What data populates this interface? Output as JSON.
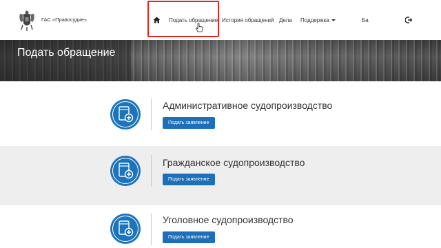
{
  "header": {
    "brand": "ГАС «Правосудие»",
    "nav": {
      "home_icon": "home-icon",
      "submit_appeal": "Подать обращение",
      "appeal_history": "История обращений",
      "cases": "Дела",
      "support": "Поддержка"
    },
    "user": "Ба",
    "logout_icon": "logout-icon"
  },
  "banner": {
    "title": "Подать обращение"
  },
  "sections": [
    {
      "title": "Административное судопроизводство",
      "button": "Подать заявление",
      "icon": "document-add-icon"
    },
    {
      "title": "Гражданское судопроизводство",
      "button": "Подать заявление",
      "icon": "document-add-icon"
    },
    {
      "title": "Уголовное судопроизводство",
      "button": "Подать заявление",
      "icon": "document-add-icon"
    }
  ],
  "colors": {
    "accent": "#1c75bc",
    "button": "#1c6fb8",
    "highlight": "#e32424",
    "section_alt_bg": "#eeeeee"
  }
}
